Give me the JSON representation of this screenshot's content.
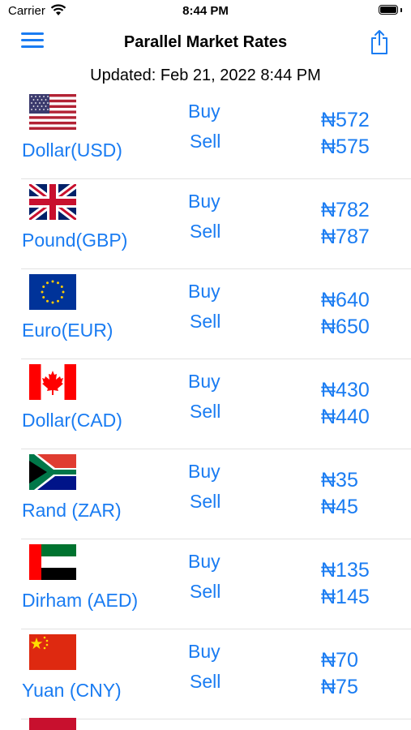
{
  "status": {
    "carrier": "Carrier",
    "time": "8:44 PM"
  },
  "nav": {
    "title": "Parallel Market Rates"
  },
  "updated": "Updated: Feb 21, 2022 8:44 PM",
  "labels": {
    "buy": "Buy",
    "sell": "Sell"
  },
  "rows": [
    {
      "name": "Dollar(USD)",
      "flag": "us-flag",
      "buy": "₦572",
      "sell": "₦575"
    },
    {
      "name": "Pound(GBP)",
      "flag": "uk-flag",
      "buy": "₦782",
      "sell": "₦787"
    },
    {
      "name": "Euro(EUR)",
      "flag": "eu-flag",
      "buy": "₦640",
      "sell": "₦650"
    },
    {
      "name": "Dollar(CAD)",
      "flag": "canada-flag",
      "buy": "₦430",
      "sell": "₦440"
    },
    {
      "name": "Rand (ZAR)",
      "flag": "south-africa-flag",
      "buy": "₦35",
      "sell": "₦45"
    },
    {
      "name": "Dirham (AED)",
      "flag": "uae-flag",
      "buy": "₦135",
      "sell": "₦145"
    },
    {
      "name": "Yuan (CNY)",
      "flag": "china-flag",
      "buy": "₦70",
      "sell": "₦75"
    }
  ],
  "colors": {
    "accent": "#1a7cf2",
    "separator": "#e2e2e2"
  },
  "icons": {
    "menu": "hamburger-menu-icon",
    "share": "share-icon",
    "wifi": "wifi-icon",
    "battery": "battery-icon"
  }
}
